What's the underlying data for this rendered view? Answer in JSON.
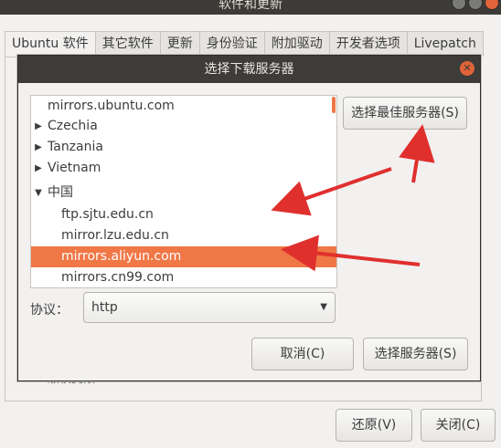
{
  "main_window": {
    "title": "软件和更新",
    "tabs": [
      "Ubuntu 软件",
      "其它软件",
      "更新",
      "身份验证",
      "附加驱动",
      "开发者选项",
      "Livepatch"
    ],
    "partial_text": "版权受限",
    "revert_label": "还原(V)",
    "close_label": "关闭(C)"
  },
  "dialog": {
    "title": "选择下载服务器",
    "best_server_label": "选择最佳服务器(S)",
    "protocol_label": "协议：",
    "protocol_value": "http",
    "cancel_label": "取消(C)",
    "choose_label": "选择服务器(S)",
    "items": [
      {
        "label": "mirrors.ubuntu.com",
        "indent": 0,
        "expander": ""
      },
      {
        "label": "Czechia",
        "indent": 1,
        "expander": "▶"
      },
      {
        "label": "Tanzania",
        "indent": 1,
        "expander": "▶"
      },
      {
        "label": "Vietnam",
        "indent": 1,
        "expander": "▶"
      },
      {
        "label": "中国",
        "indent": 1,
        "expander": "▼"
      },
      {
        "label": "ftp.sjtu.edu.cn",
        "indent": 2,
        "expander": ""
      },
      {
        "label": "mirror.lzu.edu.cn",
        "indent": 2,
        "expander": ""
      },
      {
        "label": "mirrors.aliyun.com",
        "indent": 2,
        "expander": "",
        "selected": true
      },
      {
        "label": "mirrors.cn99.com",
        "indent": 2,
        "expander": ""
      }
    ]
  },
  "colors": {
    "accent": "#f07746",
    "titlebar": "#3c3b37",
    "annotation_arrow": "#e0302e"
  }
}
